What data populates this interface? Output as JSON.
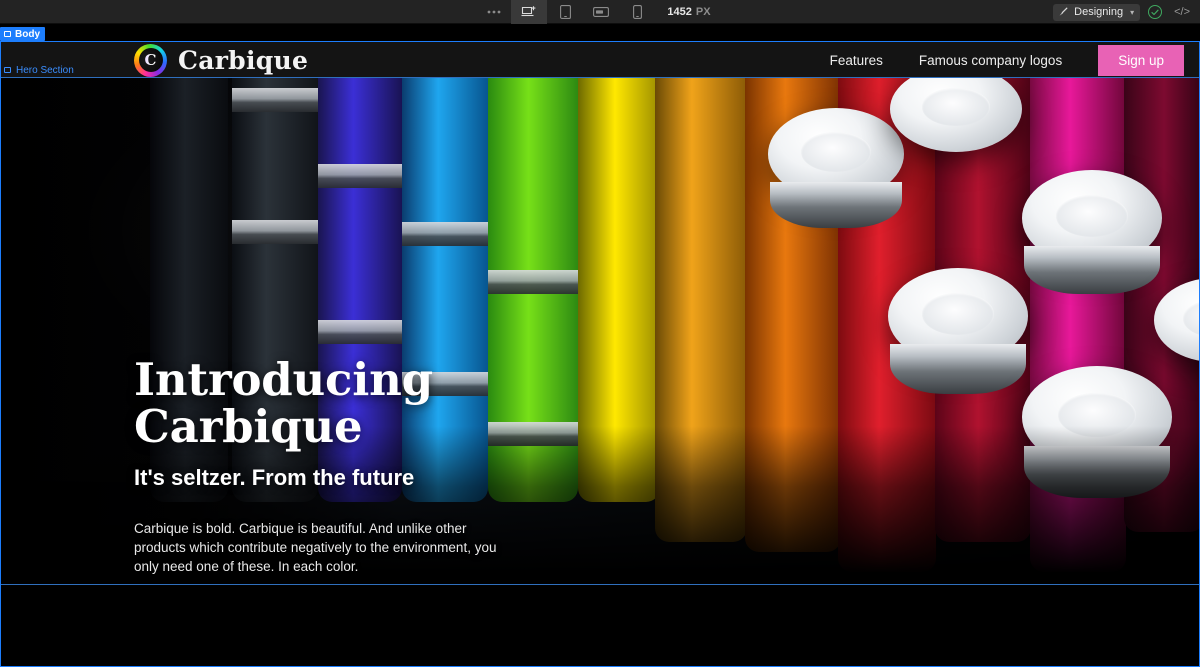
{
  "toolbar": {
    "more_label": "•••",
    "devices": [
      {
        "name": "desktop",
        "label": "Desktop",
        "active": true
      },
      {
        "name": "tablet",
        "label": "Tablet",
        "active": false
      },
      {
        "name": "tablet-landscape",
        "label": "Tablet landscape",
        "active": false
      },
      {
        "name": "mobile",
        "label": "Mobile",
        "active": false
      }
    ],
    "viewport_width": "1452",
    "viewport_unit": "PX",
    "mode_label": "Designing",
    "mode_chevron": "▾",
    "check_glyph": "✓",
    "code_label": "</>"
  },
  "canvas": {
    "selection_label": "Body",
    "section_label": "Hero Section",
    "selection_color": "#1d7efd"
  },
  "site": {
    "nav": {
      "brand_initial": "C",
      "brand_name": "Carbique",
      "links": [
        {
          "label": "Features"
        },
        {
          "label": "Famous company logos"
        }
      ],
      "cta_label": "Sign up",
      "cta_color": "#e862b5"
    },
    "hero": {
      "heading": "Introducing Carbique",
      "subheading": "It's seltzer. From the future",
      "paragraph": "Carbique is bold. Carbique is beautiful. And unlike other products which contribute negatively to the environment, you only need one of these. In each color."
    }
  }
}
